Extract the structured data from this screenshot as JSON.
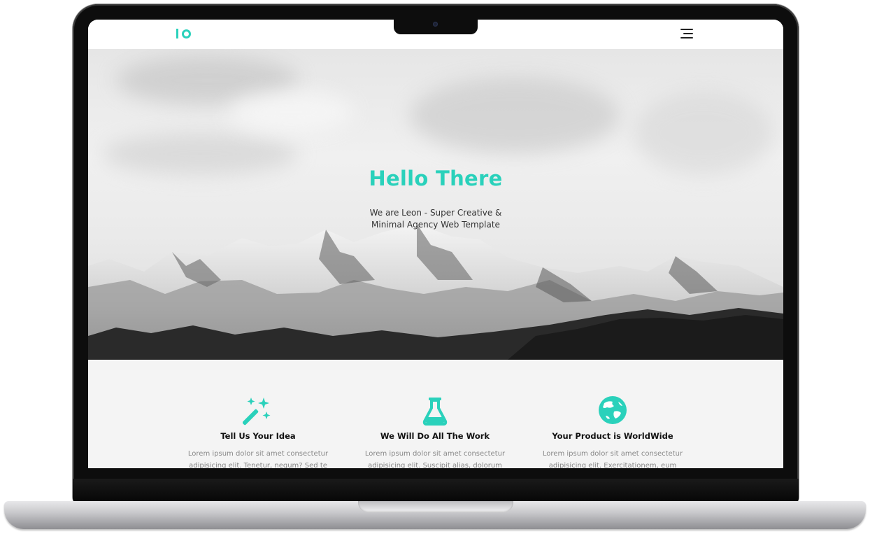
{
  "brand": {
    "logo_text": "IO",
    "accent": "#2ad1bb"
  },
  "nav": {
    "menu_icon": "hamburger-icon"
  },
  "hero": {
    "title": "Hello There",
    "subtitle_line1": "We are Leon - Super Creative &",
    "subtitle_line2": "Minimal Agency Web Template"
  },
  "features": [
    {
      "icon": "magic-wand-icon",
      "title": "Tell Us Your Idea",
      "desc_line1": "Lorem ipsum dolor sit amet consectetur",
      "desc_line2": "adipisicing elit. Tenetur, nequm? Sed te"
    },
    {
      "icon": "flask-icon",
      "title": "We Will Do All The Work",
      "desc_line1": "Lorem ipsum dolor sit amet consectetur",
      "desc_line2": "adipisicing elit. Suscipit alias, dolorum"
    },
    {
      "icon": "globe-icon",
      "title": "Your Product is WorldWide",
      "desc_line1": "Lorem ipsum dolor sit amet consectetur",
      "desc_line2": "adipisicing elit. Exercitationem, eum"
    }
  ]
}
